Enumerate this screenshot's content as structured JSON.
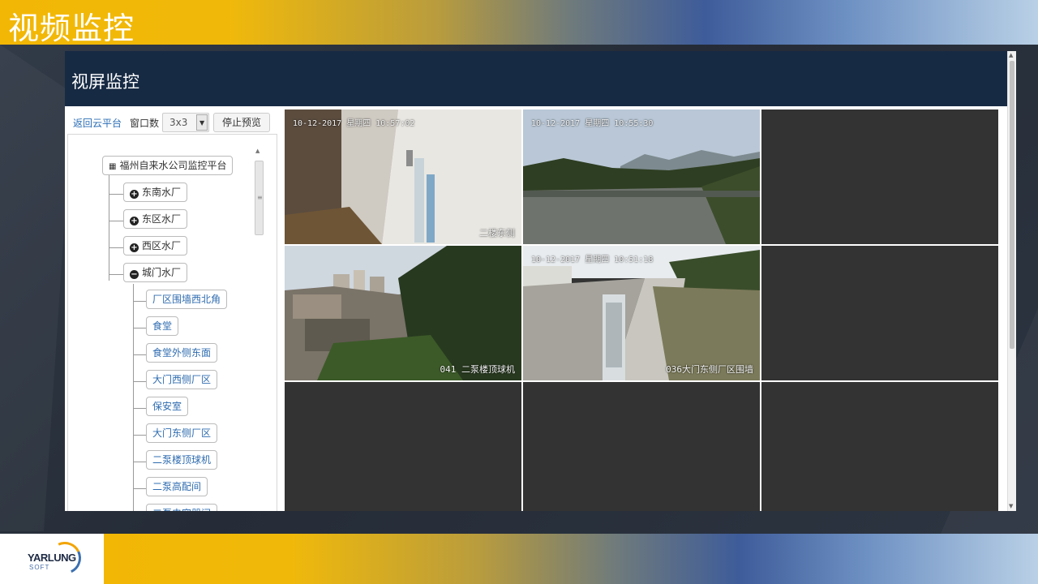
{
  "slide": {
    "title": "视频监控",
    "logo": {
      "text": "YARLUNG",
      "sub": "SOFT"
    }
  },
  "app": {
    "title": "视屏监控",
    "toolbar": {
      "back_label": "返回云平台",
      "window_count_label": "窗口数",
      "window_count_value": "3x3",
      "stop_preview_label": "停止预览"
    },
    "tree": {
      "root": "福州自来水公司监控平台",
      "plants": [
        {
          "label": "东南水厂",
          "icon": "plus-circle-icon",
          "expanded": false
        },
        {
          "label": "东区水厂",
          "icon": "plus-circle-icon",
          "expanded": false
        },
        {
          "label": "西区水厂",
          "icon": "plus-circle-icon",
          "expanded": false
        },
        {
          "label": "城门水厂",
          "icon": "minus-circle-icon",
          "expanded": true
        }
      ],
      "cameras": [
        "厂区围墙西北角",
        "食堂",
        "食堂外侧东面",
        "大门西侧厂区",
        "保安室",
        "大门东侧厂区",
        "二泵楼顶球机",
        "二泵高配间",
        "二泵电容器间"
      ]
    },
    "video_cells": [
      {
        "timestamp": "10-12-2017 星期四 10:57:02",
        "caption": "二楼东侧",
        "active": true,
        "scene": "corridor"
      },
      {
        "timestamp": "10-12-2017 星期四 10:55:30",
        "caption": "",
        "active": false,
        "scene": "river"
      },
      {
        "timestamp": "",
        "caption": "",
        "active": false,
        "scene": "empty"
      },
      {
        "timestamp": "",
        "caption": "041 二泵楼顶球机",
        "active": false,
        "scene": "town"
      },
      {
        "timestamp": "10-12-2017 星期四 10:51:18",
        "caption": "036大门东侧厂区围墙",
        "active": false,
        "scene": "road"
      },
      {
        "timestamp": "",
        "caption": "",
        "active": false,
        "scene": "empty"
      },
      {
        "timestamp": "",
        "caption": "",
        "active": false,
        "scene": "empty"
      },
      {
        "timestamp": "",
        "caption": "",
        "active": false,
        "scene": "empty"
      },
      {
        "timestamp": "",
        "caption": "",
        "active": false,
        "scene": "empty"
      }
    ]
  },
  "colors": {
    "header_bg": "#172a44",
    "cell_bg": "#333333",
    "link": "#2a6db5",
    "accent_yellow": "#f2b705",
    "accent_blue": "#3e5c9a"
  }
}
